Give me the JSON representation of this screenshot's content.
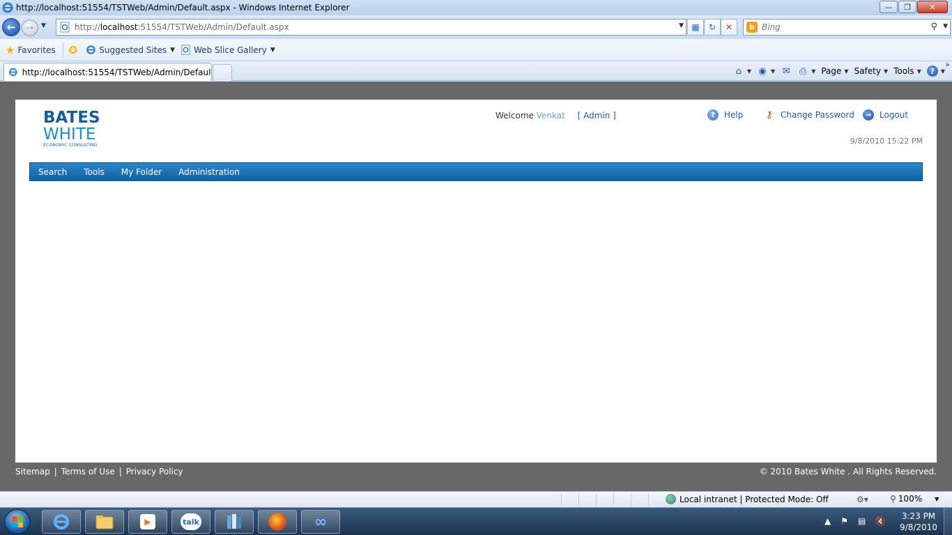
{
  "window": {
    "title": "http://localhost:51554/TSTWeb/Admin/Default.aspx - Windows Internet Explorer",
    "minimize": "—",
    "restore": "❐",
    "close": "✕"
  },
  "addressbar": {
    "url_prefix": "http://",
    "url_host": "localhost",
    "url_rest": ":51554/TSTWeb/Admin/Default.aspx",
    "search_placeholder": "Bing"
  },
  "favorites": {
    "label": "Favorites",
    "items": [
      "Suggested Sites",
      "Web Slice Gallery"
    ]
  },
  "tab": {
    "label": "http://localhost:51554/TSTWeb/Admin/Default.a..."
  },
  "commandbar": {
    "page": "Page",
    "safety": "Safety",
    "tools": "Tools"
  },
  "site": {
    "logo_line1": "BATES",
    "logo_line2": "WHITE",
    "logo_line3": "ECONOMIC CONSULTING",
    "welcome_label": "Welcome",
    "welcome_user": "Venkat",
    "role": "[  Admin  ]",
    "help": "Help",
    "change_password": "Change Password",
    "logout": "Logout",
    "datetime": "9/8/2010 15:22 PM",
    "menu": [
      "Search",
      "Tools",
      "My Folder",
      "Administration"
    ],
    "footer_links": [
      "Sitemap",
      "Terms of Use",
      "Privacy Policy"
    ],
    "footer_sep": "|",
    "copyright": "© 2010 Bates White . All Rights Reserved."
  },
  "statusbar": {
    "zone": "Local intranet | Protected Mode: Off",
    "zoom": "100%"
  },
  "taskbar": {
    "time": "3:23 PM",
    "date": "9/8/2010",
    "talk_label": "talk"
  },
  "colors": {
    "brand_blue": "#1b5c9c",
    "menubar": "#1b74bd",
    "viewport_bg": "#686868"
  }
}
